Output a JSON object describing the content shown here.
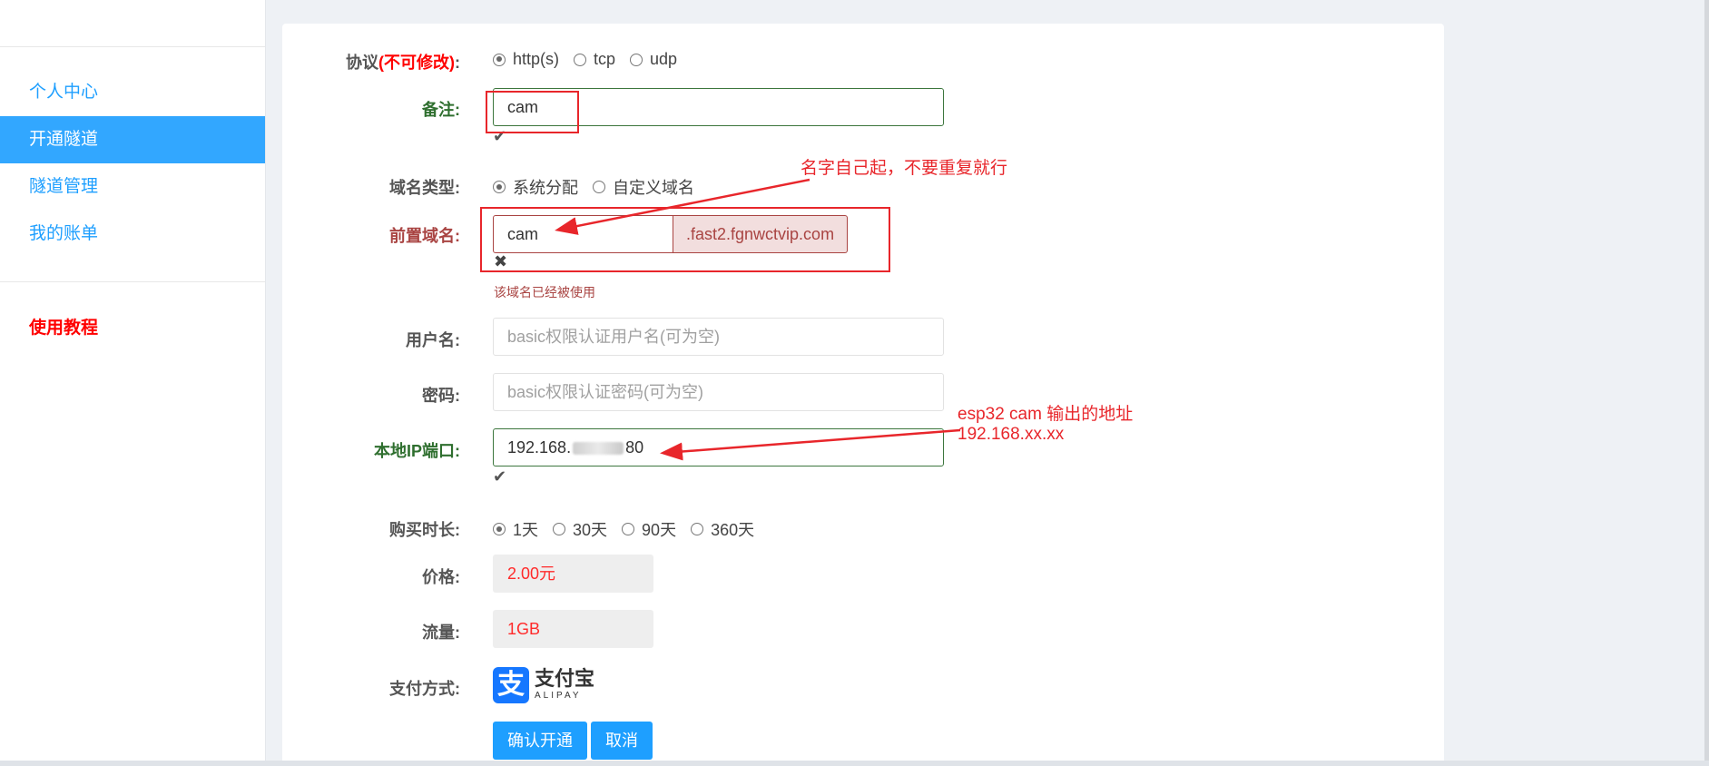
{
  "sidebar": {
    "items": [
      {
        "label": "个人中心",
        "active": false
      },
      {
        "label": "开通隧道",
        "active": true
      },
      {
        "label": "隧道管理",
        "active": false
      },
      {
        "label": "我的账单",
        "active": false
      }
    ],
    "tutorial": "使用教程"
  },
  "form": {
    "protocol": {
      "label": "协议",
      "label_note": "(不可修改)",
      "label_colon": ":",
      "options": [
        "http(s)",
        "tcp",
        "udp"
      ],
      "selected": "http(s)"
    },
    "remark": {
      "label": "备注:",
      "value": "cam",
      "status_icon": "check-icon"
    },
    "domain_type": {
      "label": "域名类型:",
      "options": [
        "系统分配",
        "自定义域名"
      ],
      "selected": "系统分配"
    },
    "prefix_domain": {
      "label": "前置域名:",
      "value": "cam",
      "suffix": ".fast2.fgnwctvip.com",
      "status_icon": "times-icon",
      "error": "该域名已经被使用"
    },
    "username": {
      "label": "用户名:",
      "placeholder": "basic权限认证用户名(可为空)"
    },
    "password": {
      "label": "密码:",
      "placeholder": "basic权限认证密码(可为空)"
    },
    "local_ip": {
      "label": "本地IP端口:",
      "value_prefix": "192.168.",
      "value_suffix": "80",
      "status_icon": "check-icon"
    },
    "duration": {
      "label": "购买时长:",
      "options": [
        "1天",
        "30天",
        "90天",
        "360天"
      ],
      "selected": "1天"
    },
    "price": {
      "label": "价格:",
      "value": "2.00元"
    },
    "traffic": {
      "label": "流量:",
      "value": "1GB"
    },
    "payment": {
      "label": "支付方式:",
      "logo_cn": "支付宝",
      "logo_en": "ALIPAY",
      "logo_icon": "alipay-icon"
    },
    "buttons": {
      "confirm": "确认开通",
      "cancel": "取消"
    }
  },
  "annotations": {
    "name_note": "名字自己起，不要重复就行",
    "ip_note_line1": "esp32 cam 输出的地址",
    "ip_note_line2": "192.168.xx.xx",
    "color": "#e8262b"
  },
  "colors": {
    "accent": "#1e9fff",
    "active_nav": "#32a7ff",
    "success": "#3c763d",
    "error": "#a94442",
    "tutorial": "#ff0000"
  }
}
